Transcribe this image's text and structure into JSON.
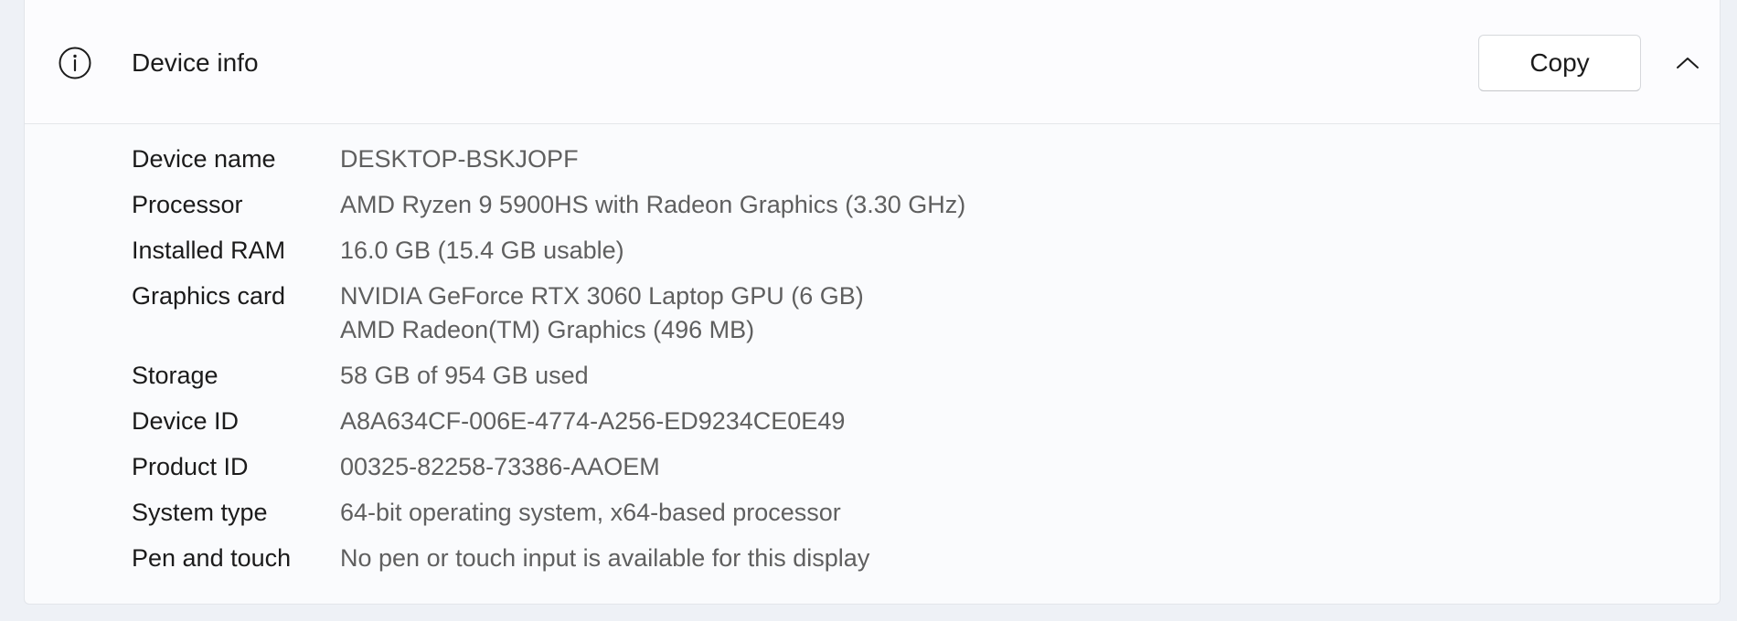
{
  "section": {
    "title": "Device info",
    "icon": "info-icon",
    "collapse_icon": "chevron-up-icon",
    "copy_label": "Copy"
  },
  "specs": [
    {
      "label": "Device name",
      "values": [
        "DESKTOP-BSKJOPF"
      ]
    },
    {
      "label": "Processor",
      "values": [
        "AMD Ryzen 9 5900HS with Radeon Graphics (3.30 GHz)"
      ]
    },
    {
      "label": "Installed RAM",
      "values": [
        "16.0 GB (15.4 GB usable)"
      ]
    },
    {
      "label": "Graphics card",
      "values": [
        "NVIDIA GeForce RTX 3060 Laptop GPU (6 GB)",
        "AMD Radeon(TM) Graphics (496 MB)"
      ]
    },
    {
      "label": "Storage",
      "values": [
        "58 GB of 954 GB used"
      ]
    },
    {
      "label": "Device ID",
      "values": [
        "A8A634CF-006E-4774-A256-ED9234CE0E49"
      ]
    },
    {
      "label": "Product ID",
      "values": [
        "00325-82258-73386-AAOEM"
      ]
    },
    {
      "label": "System type",
      "values": [
        "64-bit operating system, x64-based processor"
      ]
    },
    {
      "label": "Pen and touch",
      "values": [
        "No pen or touch input is available for this display"
      ]
    }
  ]
}
